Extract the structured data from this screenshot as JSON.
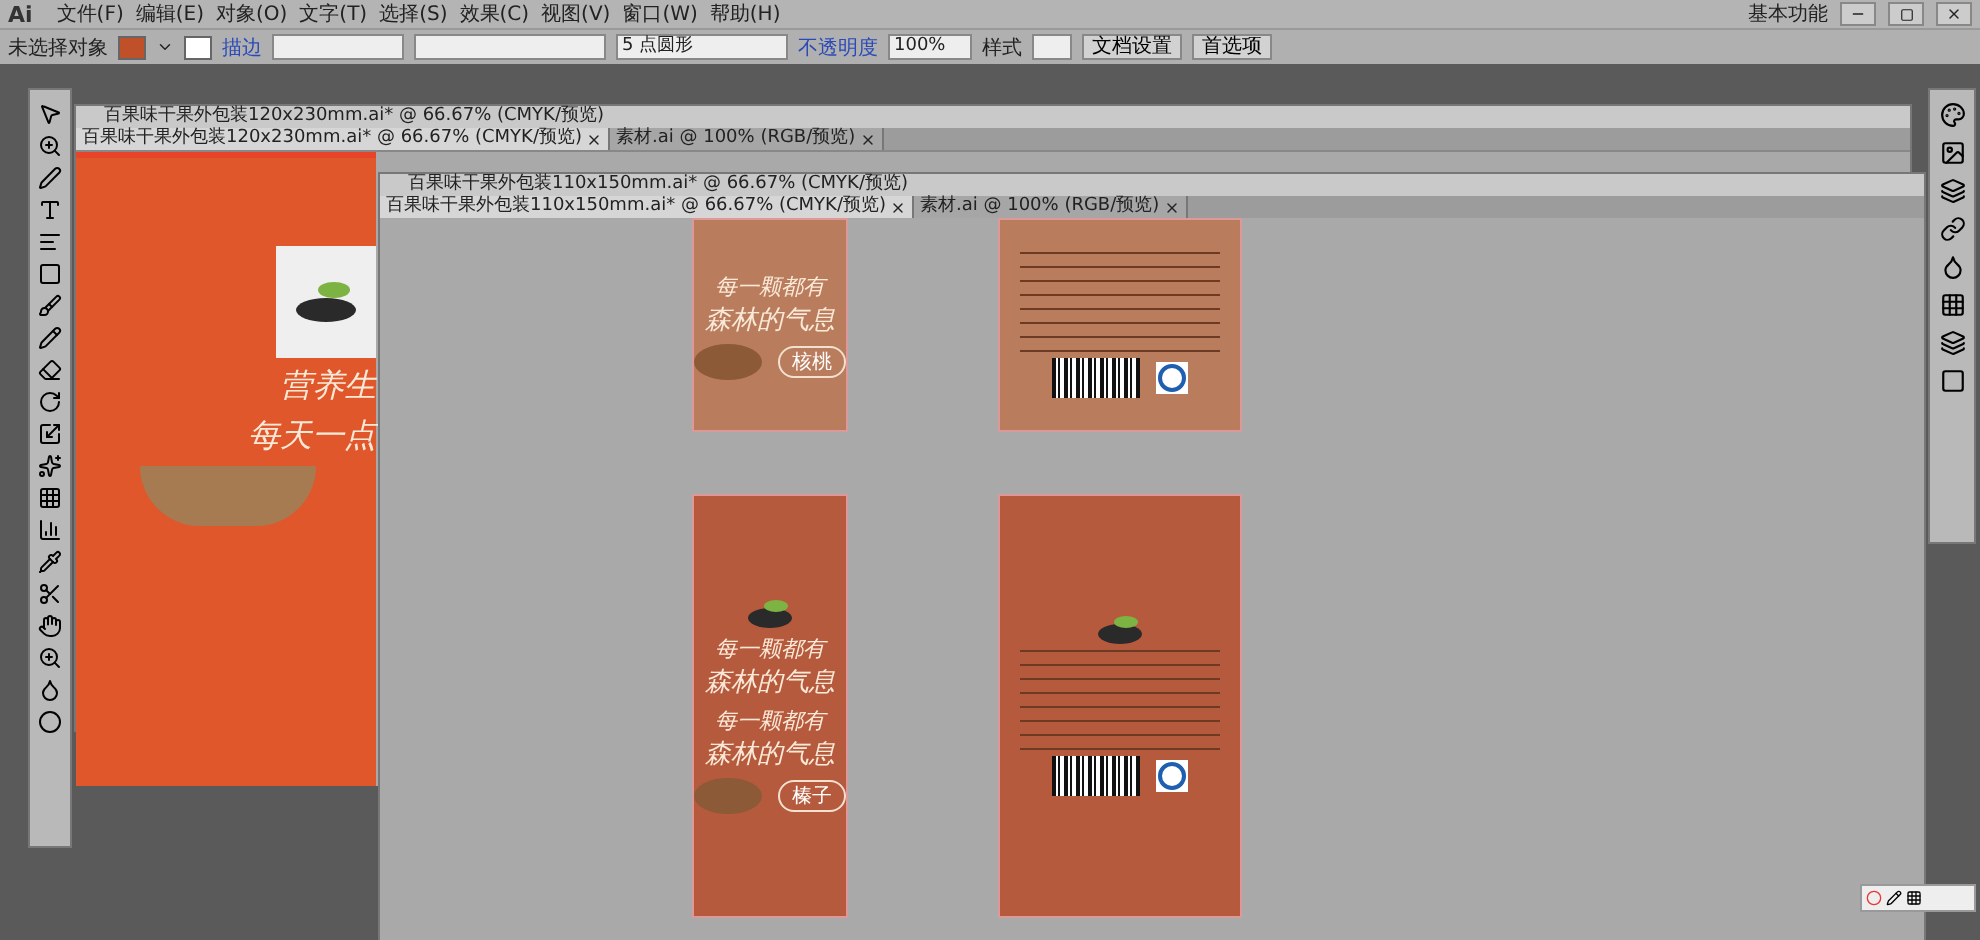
{
  "menu": {
    "logo": "Ai",
    "items": [
      "文件(F)",
      "编辑(E)",
      "对象(O)",
      "文字(T)",
      "选择(S)",
      "效果(C)",
      "视图(V)",
      "窗口(W)",
      "帮助(H)"
    ],
    "workspace": "基本功能"
  },
  "control_bar": {
    "selection": "未选择对象",
    "stroke_label": "描边",
    "brush": "5 点圆形",
    "opacity_label": "不透明度",
    "opacity": "100%",
    "style_label": "样式",
    "buttons": [
      "文档设置",
      "首选项"
    ]
  },
  "windows": [
    {
      "title": "百果味干果外包装120x230mm.ai* @ 66.67% (CMYK/预览)",
      "tabs": [
        {
          "label": "百果味干果外包装120x230mm.ai* @ 66.67% (CMYK/预览)",
          "selected": true
        },
        {
          "label": "素材.ai @ 100% (RGB/预览)",
          "selected": false
        }
      ]
    },
    {
      "title": "百果味干果外包装110x150mm.ai* @ 66.67% (CMYK/预览)",
      "tabs": [
        {
          "label": "百果味干果外包装110x150mm.ai* @ 66.67% (CMYK/预览)",
          "selected": true
        },
        {
          "label": "素材.ai @ 100% (RGB/预览)",
          "selected": false
        }
      ]
    }
  ],
  "left_artwork": {
    "lines": [
      "营养生",
      "每天一点"
    ]
  },
  "artboards": [
    {
      "kind": "front",
      "color": "#b97d5e",
      "logo": false,
      "slogans": [
        {
          "line1": "每一颗都有",
          "line2": "森林的气息"
        }
      ],
      "badge": "核桃"
    },
    {
      "kind": "back",
      "color": "#b97d5e",
      "logo": false
    },
    {
      "kind": "front",
      "color": "#b65a3e",
      "logo": true,
      "slogans": [
        {
          "line1": "每一颗都有",
          "line2": "森林的气息"
        },
        {
          "line1": "每一颗都有",
          "line2": "森林的气息"
        }
      ],
      "badge": "榛子"
    },
    {
      "kind": "back",
      "color": "#b65a3e",
      "logo": true
    }
  ]
}
